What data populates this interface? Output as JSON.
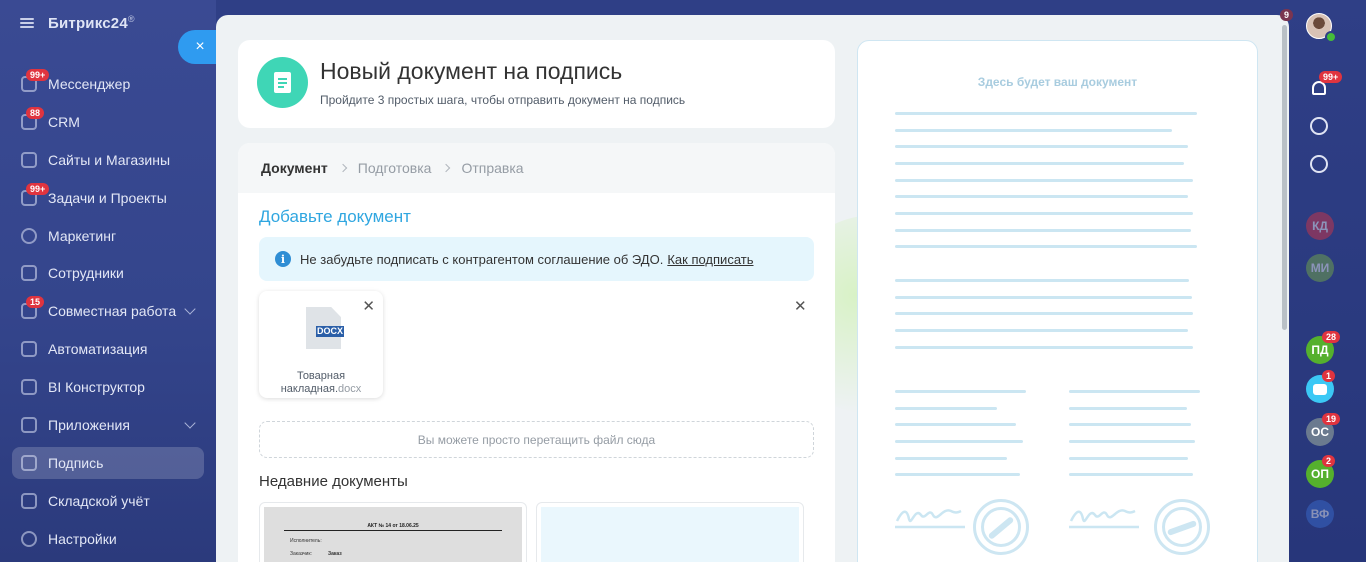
{
  "sidebar": {
    "brand": "Битрикс24",
    "brand_mark": "®",
    "items": [
      {
        "label": "Мессенджер",
        "badge": "99+"
      },
      {
        "label": "CRM",
        "badge": "88"
      },
      {
        "label": "Сайты и Магазины",
        "badge": ""
      },
      {
        "label": "Задачи и Проекты",
        "badge": "99+"
      },
      {
        "label": "Маркетинг",
        "badge": ""
      },
      {
        "label": "Сотрудники",
        "badge": ""
      },
      {
        "label": "Совместная работа",
        "badge": "15"
      },
      {
        "label": "Автоматизация",
        "badge": ""
      },
      {
        "label": "BI Конструктор",
        "badge": ""
      },
      {
        "label": "Приложения",
        "badge": ""
      },
      {
        "label": "Подпись",
        "badge": ""
      },
      {
        "label": "Складской учёт",
        "badge": ""
      },
      {
        "label": "Настройки",
        "badge": ""
      }
    ]
  },
  "slider": {
    "close_label": "×"
  },
  "header": {
    "title": "Новый документ на подпись",
    "subtitle": "Пройдите 3 простых шага, чтобы отправить документ на подпись"
  },
  "steps": [
    "Документ",
    "Подготовка",
    "Отправка"
  ],
  "main": {
    "section_title": "Добавьте документ",
    "info_text": "Не забудьте подписать с контрагентом соглашение об ЭДО.",
    "info_link": "Как подписать",
    "file": {
      "ext_badge": "DOCX",
      "name": "Товарная накладная.",
      "ext": "docx"
    },
    "dropzone": "Вы можете просто перетащить файл сюда",
    "recent_title": "Недавние документы",
    "recent_doc_title": "АКТ № 14 от 18.06.25",
    "recent_doc_field1": "Исполнитель:",
    "recent_doc_field2": "Заказчик:",
    "recent_doc_value2": "Заказ"
  },
  "preview": {
    "label": "Здесь будет ваш документ"
  },
  "rightbar": {
    "avatar_badge": "9",
    "notify_badge": "99+",
    "chats": [
      {
        "initials": "КД",
        "color": "#e0343f",
        "badge": "",
        "faded": true
      },
      {
        "initials": "МИ",
        "color": "#7cb342",
        "badge": "",
        "faded": true
      },
      {
        "initials": "ПД",
        "color": "#55b02d",
        "badge": "28",
        "faded": false
      },
      {
        "initials": "",
        "color": "#3bc8f5",
        "badge": "1",
        "faded": false
      },
      {
        "initials": "ОС",
        "color": "#6b7a8f",
        "badge": "19",
        "faded": false
      },
      {
        "initials": "ОП",
        "color": "#55b02d",
        "badge": "2",
        "faded": false
      },
      {
        "initials": "ВФ",
        "color": "#3b6fd4",
        "badge": "",
        "faded": true
      }
    ]
  },
  "colors": {
    "accent": "#2fa6e0",
    "badge_red": "#e0343f",
    "teal": "#3fd6b6",
    "sidebar_bg": "#34458c"
  }
}
